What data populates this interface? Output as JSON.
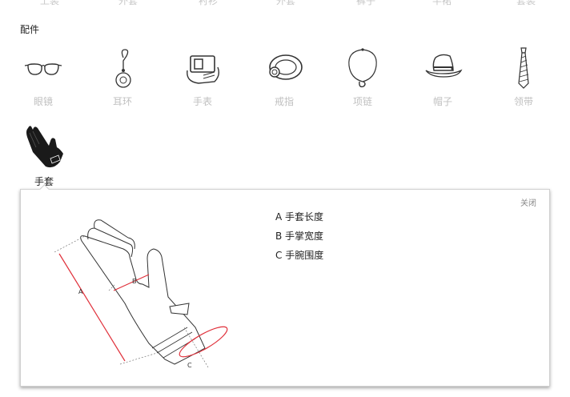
{
  "top_row": [
    "上装",
    "外套",
    "衬衫",
    "外套",
    "裤子",
    "半裙",
    "套装"
  ],
  "section_title": "配件",
  "accessories": [
    {
      "label": "眼镜",
      "icon": "glasses-icon"
    },
    {
      "label": "耳环",
      "icon": "earring-icon"
    },
    {
      "label": "手表",
      "icon": "watch-icon"
    },
    {
      "label": "戒指",
      "icon": "ring-icon"
    },
    {
      "label": "项链",
      "icon": "necklace-icon"
    },
    {
      "label": "帽子",
      "icon": "hat-icon"
    },
    {
      "label": "领带",
      "icon": "tie-icon"
    }
  ],
  "selected": {
    "label": "手套",
    "icon": "glove-icon"
  },
  "panel": {
    "close_label": "关闭",
    "measures": [
      "A 手套长度",
      "B 手掌宽度",
      "C 手腕围度"
    ],
    "diagram_labels": {
      "a": "A",
      "b": "B",
      "c": "C"
    }
  },
  "colors": {
    "measure_line": "#e0303a",
    "outline": "#333333",
    "muted_text": "#c0c0c0"
  }
}
